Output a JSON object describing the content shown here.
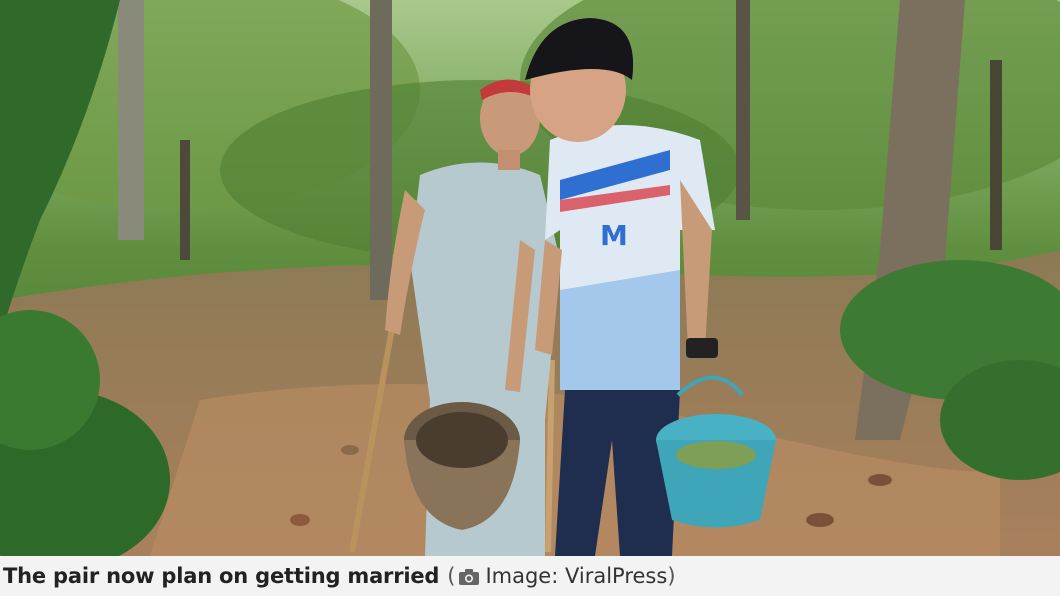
{
  "photo": {
    "subject": "two-people-in-forest",
    "jersey_logo": "M",
    "colors": {
      "foliage": "#3f6a2c",
      "path": "#b88b63",
      "jersey": "#dfe9f3",
      "jersey_accent": "#2f6fd1",
      "basket_blue": "#3fa5b8",
      "dress": "#b6c9cf",
      "jeans": "#1f2d4f"
    }
  },
  "caption": {
    "text": "The pair now plan on getting married",
    "open_paren": "(",
    "credit": "Image: ViralPress",
    "close_paren": ")",
    "icon": "camera-icon"
  }
}
